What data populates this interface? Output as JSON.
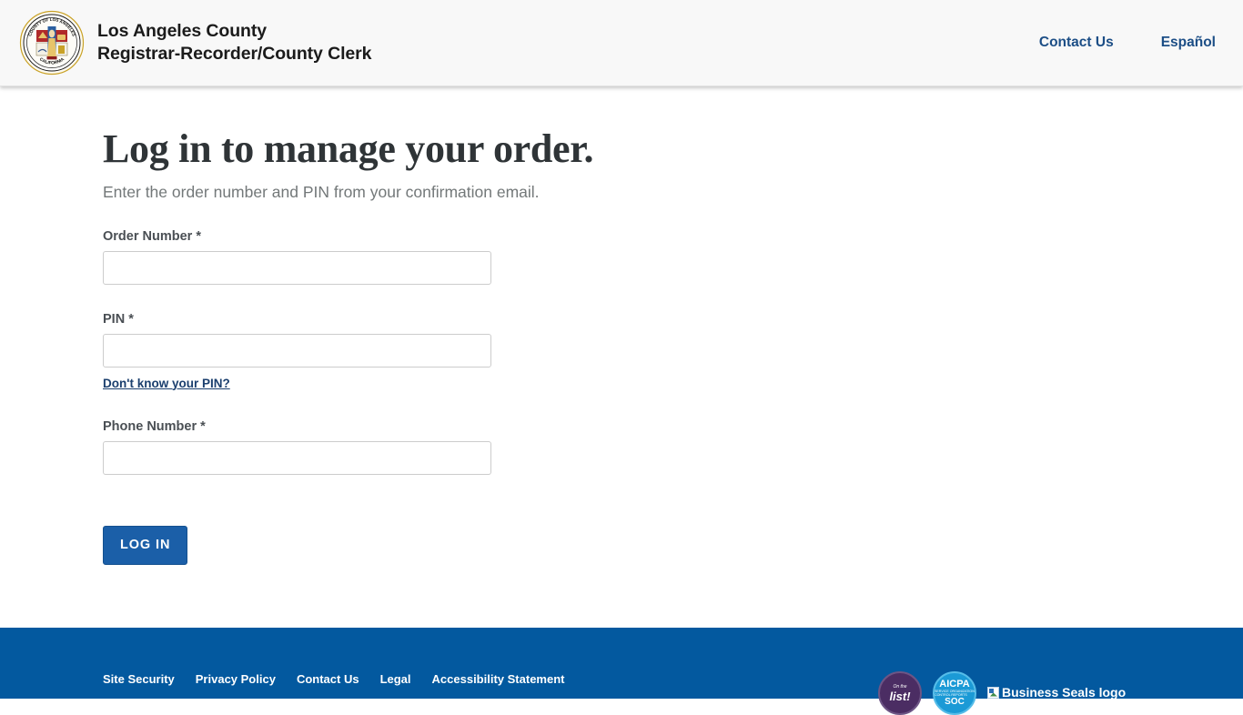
{
  "header": {
    "logo_icon": "la-county-seal-icon",
    "seal_text_top": "COUNTY OF LOS ANGELES",
    "seal_text_bottom": "CALIFORNIA",
    "title_line1": "Los Angeles County",
    "title_line2": "Registrar-Recorder/County Clerk",
    "nav": [
      {
        "label": "Contact Us",
        "name": "contact-us"
      },
      {
        "label": "Español",
        "name": "espanol"
      }
    ]
  },
  "main": {
    "title": "Log in to manage your order.",
    "subtitle": "Enter the order number and PIN from your confirmation email.",
    "fields": [
      {
        "label": "Order Number *",
        "value": "",
        "placeholder": "",
        "name": "order-number"
      },
      {
        "label": "PIN *",
        "value": "",
        "placeholder": "",
        "name": "pin"
      },
      {
        "label": "Phone Number *",
        "value": "",
        "placeholder": "",
        "name": "phone-number"
      }
    ],
    "pin_help_link": "Don't know your PIN?",
    "login_button": "LOG IN"
  },
  "footer": {
    "links": [
      {
        "label": "Site Security"
      },
      {
        "label": "Privacy Policy"
      },
      {
        "label": "Contact Us"
      },
      {
        "label": "Legal"
      },
      {
        "label": "Accessibility Statement"
      }
    ],
    "badges": [
      {
        "name": "on-the-list-badge",
        "line1": "On the",
        "line2": "list!"
      },
      {
        "name": "aicpa-soc-badge",
        "line1": "AICPA",
        "line2": "SOC",
        "caption": "SERVICE ORGANIZATION CONTROL REPORTS"
      }
    ],
    "broken_image_alt": "Business Seals logo"
  },
  "colors": {
    "header_bg": "#f8f8f8",
    "link_blue": "#1c4e86",
    "button_blue": "#1b5fa8",
    "footer_blue": "#03599f",
    "title_gray": "#2f3437",
    "subtitle_gray": "#737879"
  }
}
